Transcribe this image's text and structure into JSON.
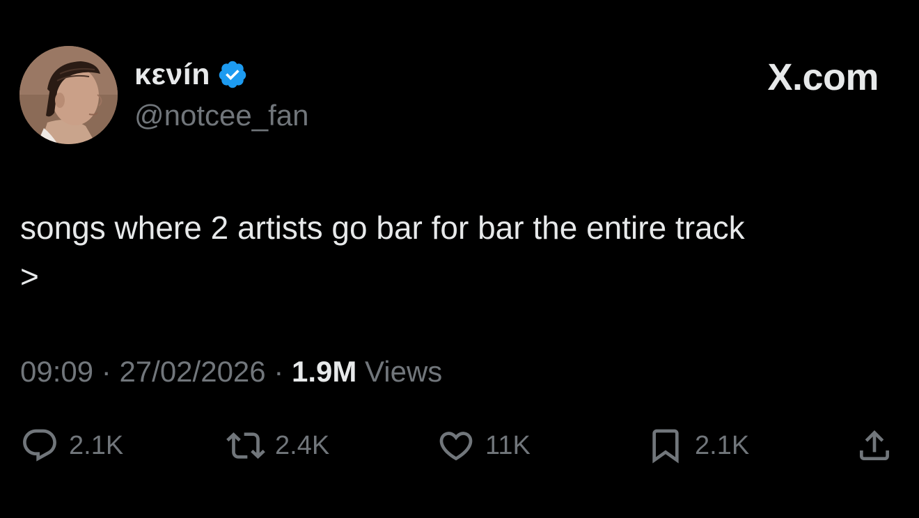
{
  "author": {
    "display_name": "κενín",
    "handle": "@notcee_fan",
    "verified": true,
    "avatar_icon": "profile-photo"
  },
  "brand": "X.com",
  "tweet": {
    "text": "songs where 2 artists go bar for bar the entire track\n>"
  },
  "meta": {
    "time": "09:09",
    "separator": " · ",
    "date": "27/02/2026",
    "views_count": "1.9M",
    "views_label": "Views"
  },
  "actions": {
    "reply": {
      "icon": "reply-icon",
      "count": "2.1K"
    },
    "retweet": {
      "icon": "retweet-icon",
      "count": "2.4K"
    },
    "like": {
      "icon": "heart-icon",
      "count": "11K"
    },
    "bookmark": {
      "icon": "bookmark-icon",
      "count": "2.1K"
    },
    "share": {
      "icon": "share-icon"
    }
  },
  "colors": {
    "background": "#000000",
    "primary_text": "#e7e9ea",
    "secondary_text": "#71767b",
    "verified_blue": "#1d9bf0"
  }
}
